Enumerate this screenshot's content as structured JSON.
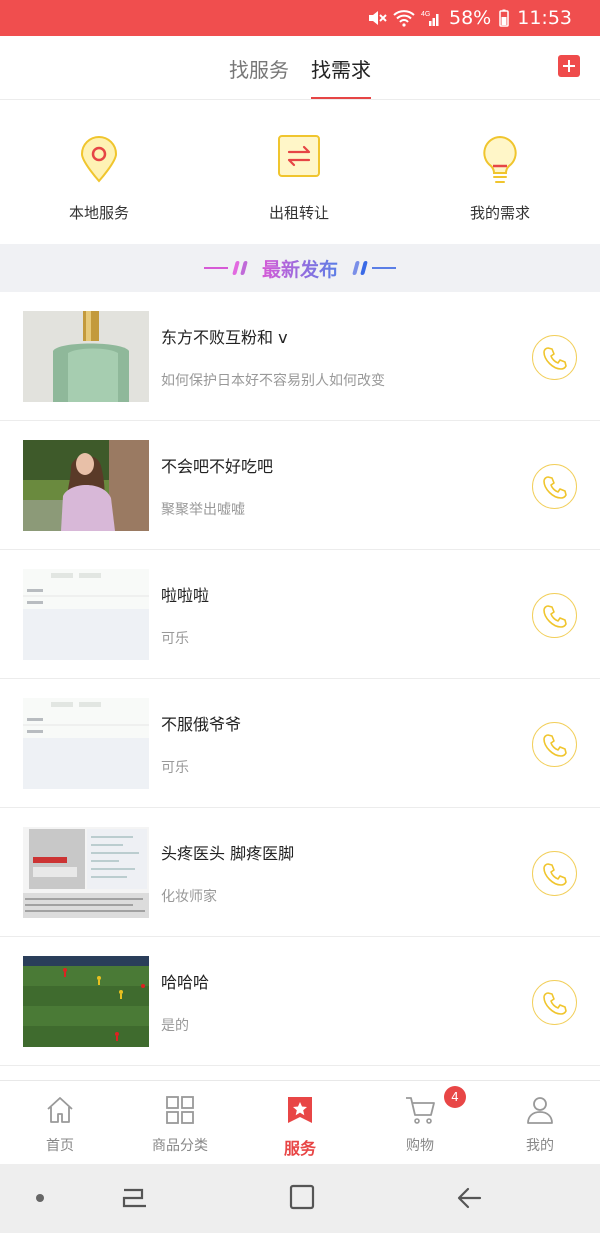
{
  "status_bar": {
    "battery": "58%",
    "time": "11:53",
    "network": "4G"
  },
  "tabs": {
    "items": [
      {
        "label": "找服务"
      },
      {
        "label": "找需求"
      }
    ],
    "active_index": 1
  },
  "quick_actions": [
    {
      "label": "本地服务",
      "icon": "location-pin-icon"
    },
    {
      "label": "出租转让",
      "icon": "swap-arrows-icon"
    },
    {
      "label": "我的需求",
      "icon": "lightbulb-icon"
    }
  ],
  "section": {
    "title": "最新发布"
  },
  "listings": [
    {
      "title": "东方不败互粉和 v",
      "subtitle": "如何保护日本好不容易别人如何改变",
      "thumb": "perfume-bottle"
    },
    {
      "title": "不会吧不好吃吧",
      "subtitle": "聚聚举出嘘嘘",
      "thumb": "girl-photo"
    },
    {
      "title": "啦啦啦",
      "subtitle": "可乐",
      "thumb": "form-screenshot"
    },
    {
      "title": "不服俄爷爷",
      "subtitle": "可乐",
      "thumb": "form-screenshot"
    },
    {
      "title": "头疼医头 脚疼医脚",
      "subtitle": "化妆师家",
      "thumb": "code-screenshot"
    },
    {
      "title": "哈哈哈",
      "subtitle": "是的",
      "thumb": "soccer-field"
    }
  ],
  "bottom_nav": {
    "items": [
      {
        "label": "首页",
        "icon": "home-icon"
      },
      {
        "label": "商品分类",
        "icon": "grid-icon"
      },
      {
        "label": "服务",
        "icon": "star-bookmark-icon"
      },
      {
        "label": "购物",
        "icon": "cart-icon"
      },
      {
        "label": "我的",
        "icon": "user-icon"
      }
    ],
    "active_index": 2,
    "cart_badge": "4"
  },
  "colors": {
    "primary": "#ef4b4b",
    "accent_yellow": "#f2cf5b"
  }
}
